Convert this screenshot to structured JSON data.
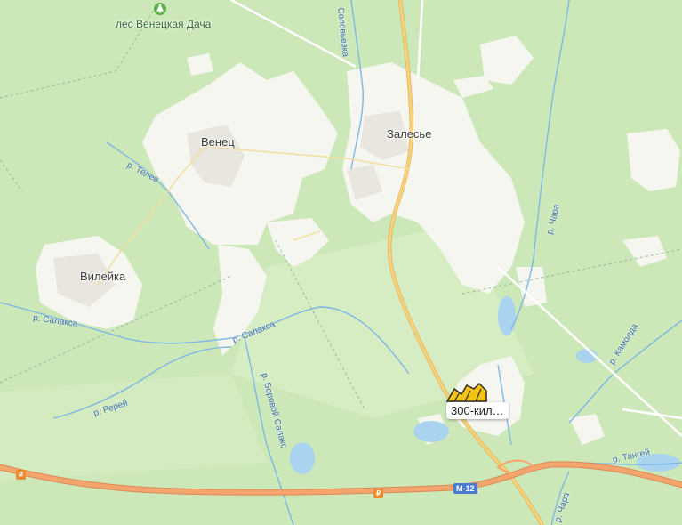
{
  "places": {
    "forest": "лес Венецкая Дача",
    "venets": "Венец",
    "zalesye": "Залесье",
    "vileyka": "Вилейка"
  },
  "rivers": {
    "solovyevka": "Соловьевка",
    "telev": "р. Телев",
    "salaksa_west": "р. Салакса",
    "salaksa_mid": "р. Салакса",
    "borovoy": "р. Боровой Салакс",
    "rerey": "р. Ререй",
    "chara_north": "р. Чара",
    "chara_south": "р. Чара",
    "kamolda": "р. Камолда",
    "tangey": "р. Тангей"
  },
  "poi": {
    "label": "300-кил…",
    "icon": "excavator-icon"
  },
  "road": {
    "shield": "М-12"
  },
  "fuel": {
    "symbol": "₽"
  },
  "colors": {
    "forest": "#cde8b8",
    "open_land": "#f6f6f1",
    "water": "#a9d3ee",
    "river": "#7fb7e4",
    "highway": "#f4a46d",
    "main_road": "#f8d27a",
    "poi_icon": "#f3c316"
  }
}
